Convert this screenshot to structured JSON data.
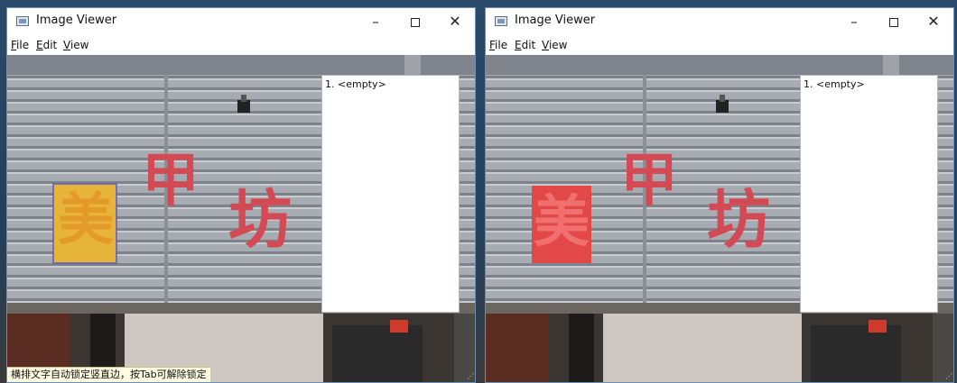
{
  "windows": [
    {
      "title": "Image Viewer",
      "controls": {
        "minimize": "–",
        "close": "✕"
      },
      "menu": [
        {
          "mnemonic": "F",
          "rest": "ile"
        },
        {
          "mnemonic": "E",
          "rest": "dit"
        },
        {
          "mnemonic": "V",
          "rest": "iew"
        }
      ],
      "list_items": [
        "1. <empty>"
      ],
      "sign_chars": [
        "美",
        "甲",
        "坊"
      ],
      "status_text": "横排文字自动锁定竖直边，按Tab可解除锁定",
      "selection_color": "#e0b030"
    },
    {
      "title": "Image Viewer",
      "controls": {
        "minimize": "–",
        "close": "✕"
      },
      "menu": [
        {
          "mnemonic": "F",
          "rest": "ile"
        },
        {
          "mnemonic": "E",
          "rest": "dit"
        },
        {
          "mnemonic": "V",
          "rest": "iew"
        }
      ],
      "list_items": [
        "1. <empty>"
      ],
      "sign_chars": [
        "美",
        "甲",
        "坊"
      ],
      "selection_color": "#e24848"
    }
  ],
  "colors": {
    "sign_red": "#d44a54",
    "panel_border": "#6d8fb4"
  }
}
